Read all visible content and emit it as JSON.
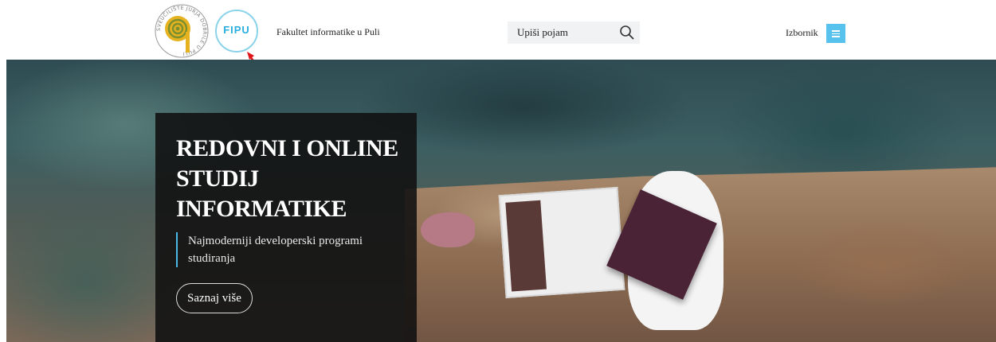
{
  "header": {
    "university_logo": {
      "icon": "spiral-logo-icon",
      "ring_text": "SVEUČILIŠTE JURJA DOBRILE U PULI",
      "colors": {
        "spiral": "#e6b21f",
        "ring": "#8b8b8b"
      }
    },
    "fipu_logo": {
      "text": "FIPU",
      "icon": "fipu-circle-logo",
      "color": "#29aee0"
    },
    "faculty_name": "Fakultet informatike u Puli",
    "search": {
      "placeholder": "Upiši pojam",
      "icon": "search-icon"
    },
    "menu": {
      "label": "Izbornik",
      "icon": "hamburger-menu-icon",
      "color": "#58c2ee"
    },
    "annotation_arrow_color": "#e0161b"
  },
  "hero": {
    "title": "REDOVNI I ONLINE STUDIJ INFORMATIKE",
    "subtitle": "Najmoderniji developerski programi studiranja",
    "cta_label": "Saznaj više",
    "accent_color": "#4ab8e8"
  }
}
